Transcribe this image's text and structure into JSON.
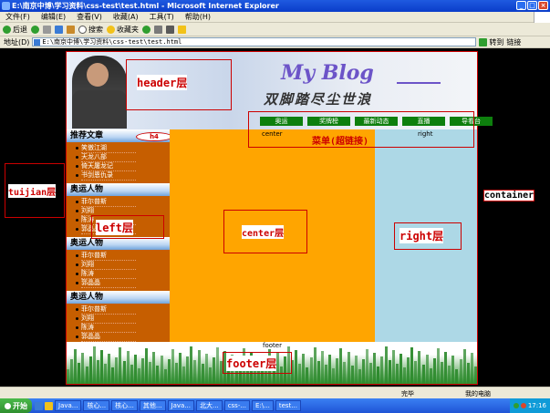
{
  "window": {
    "title": "E:\\南京中博\\学习资料\\css-test\\test.html - Microsoft Internet Explorer"
  },
  "menu": [
    "文件(F)",
    "编辑(E)",
    "查看(V)",
    "收藏(A)",
    "工具(T)",
    "帮助(H)"
  ],
  "toolbar": {
    "back": "后退",
    "search": "搜索",
    "favorites": "收藏夹"
  },
  "address": {
    "label": "地址(D)",
    "value": "E:\\南京中博\\学习资料\\css-test\\test.html",
    "go": "转到",
    "links": "链接"
  },
  "header": {
    "title": "My Blog",
    "slogan": "双脚踏尽尘世浪"
  },
  "nav": [
    "奥运",
    "奖牌榜",
    "最新动态",
    "直播",
    "导看台"
  ],
  "left": {
    "sections": [
      {
        "title": "推荐文章",
        "items": [
          "笑傲江湖",
          "天龙八部",
          "倚天屠龙记",
          "书剑恩仇录"
        ]
      },
      {
        "title": "奥运人物",
        "items": [
          "菲尔普斯",
          "刘翔",
          "陈涛",
          "郭晶晶"
        ]
      },
      {
        "title": "奥运人物",
        "items": [
          "菲尔普斯",
          "刘翔",
          "陈涛",
          "郭晶晶"
        ]
      },
      {
        "title": "奥运人物",
        "items": [
          "菲尔普斯",
          "刘翔",
          "陈涛",
          "郭晶晶"
        ]
      }
    ]
  },
  "center": {
    "text": "center"
  },
  "right": {
    "text": "right"
  },
  "footer": {
    "text": "footer"
  },
  "annotations": {
    "header": "header层",
    "menu": "菜单(超链接)",
    "h4": "h4",
    "tuijian": "tuijian层",
    "left": "left层",
    "center": "center层",
    "right": "right层",
    "container": "container",
    "footer": "footer层"
  },
  "status": {
    "left": "完毕",
    "zone": "我的电脑"
  },
  "taskbar": {
    "start": "开始",
    "tasks": [
      "Java...",
      "核心...",
      "核心...",
      "其他...",
      "Java...",
      "北大...",
      "css-...",
      "E:\\...",
      "test..."
    ],
    "clock": "17:16"
  }
}
